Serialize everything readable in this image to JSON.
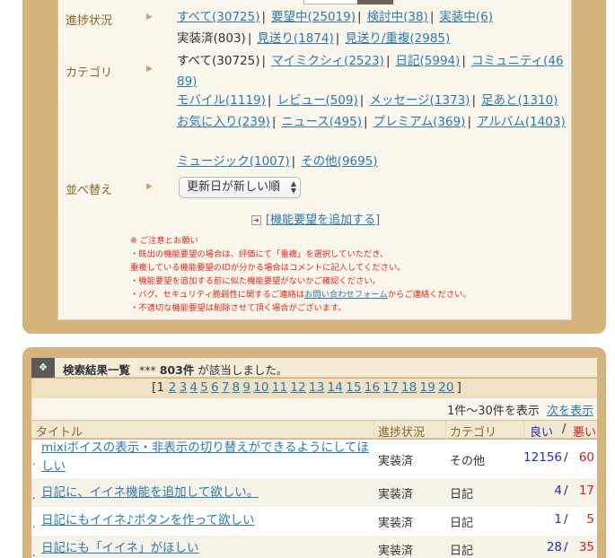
{
  "filter": {
    "progress_label": "進捗状況",
    "progress_options": [
      {
        "label": "すべて(30725)",
        "link": true
      },
      {
        "label": "要望中(25019)",
        "link": true
      },
      {
        "label": "検討中(38)",
        "link": true
      },
      {
        "label": "実装中(6)",
        "link": true
      },
      {
        "label": "実装済(803)",
        "link": false
      },
      {
        "label": "見送り(1874)",
        "link": true
      },
      {
        "label": "見送り/重複(2985)",
        "link": true
      }
    ],
    "category_label": "カテゴリ",
    "category_options": [
      {
        "label": "すべて(30725)",
        "link": false
      },
      {
        "label": "マイミクシィ(2523)",
        "link": true
      },
      {
        "label": "日記(5994)",
        "link": true
      },
      {
        "label": "コミュニティ(4689)",
        "link": true
      },
      {
        "label": "モバイル(1119)",
        "link": true
      },
      {
        "label": "レビュー(509)",
        "link": true
      },
      {
        "label": "メッセージ(1373)",
        "link": true
      },
      {
        "label": "足あと(1310)",
        "link": true
      },
      {
        "label": "お気に入り(239)",
        "link": true
      },
      {
        "label": "ニュース(495)",
        "link": true
      },
      {
        "label": "プレミアム(369)",
        "link": true
      },
      {
        "label": "アルバム(1403)",
        "link": true
      },
      {
        "label": "ミュージック(1007)",
        "link": true
      },
      {
        "label": "その他(9695)",
        "link": true
      }
    ],
    "sort_label": "並べ替え",
    "sort_value": "更新日が新しい順",
    "add_request": "[機能要望を追加する]",
    "notes": [
      "※ ご注意とお願い",
      "・既出の機能要望の場合は、評価にて「重複」を選択していただき、",
      "重複している機能要望のIDが分かる場合はコメントに記入してください。",
      "・機能要望を追加する前に似た機能要望がないかご確認ください。",
      "・不適切な機能要望は削除させて頂く場合がございます。"
    ],
    "note_bug_prefix": "・バグ、セキュリティ脆弱性に関するご連絡は",
    "note_bug_link": "お問い合わせフォーム",
    "note_bug_suffix": "からご連絡ください。"
  },
  "results": {
    "title": "検索結果一覧",
    "count_prefix": "***",
    "count": "803件",
    "count_suffix": "が該当しました。",
    "pager_open": "[1",
    "pages": [
      "2",
      "3",
      "4",
      "5",
      "6",
      "7",
      "8",
      "9",
      "10",
      "11",
      "12",
      "13",
      "14",
      "15",
      "16",
      "17",
      "18",
      "19",
      "20"
    ],
    "pager_close": "]",
    "range_text": "1件〜30件を表示",
    "next_label": "次を表示",
    "columns": {
      "title": "タイトル",
      "status": "進捗状況",
      "category": "カテゴリ",
      "good": "良い",
      "slash": "/",
      "bad": "悪い"
    },
    "rows": [
      {
        "title": "mixiボイスの表示・非表示の切り替えができるようにしてほしい",
        "status": "実装済",
        "category": "その他",
        "good": "12156",
        "bad": "60"
      },
      {
        "title": "日記に、イイネ機能を追加して欲しい。",
        "status": "実装済",
        "category": "日記",
        "good": "4",
        "bad": "17"
      },
      {
        "title": "日記にもイイネ♪ボタンを作って欲しい",
        "status": "実装済",
        "category": "日記",
        "good": "1",
        "bad": "5"
      },
      {
        "title": "日記にも「イイネ」がほしい",
        "status": "実装済",
        "category": "日記",
        "good": "28",
        "bad": "35"
      }
    ]
  }
}
